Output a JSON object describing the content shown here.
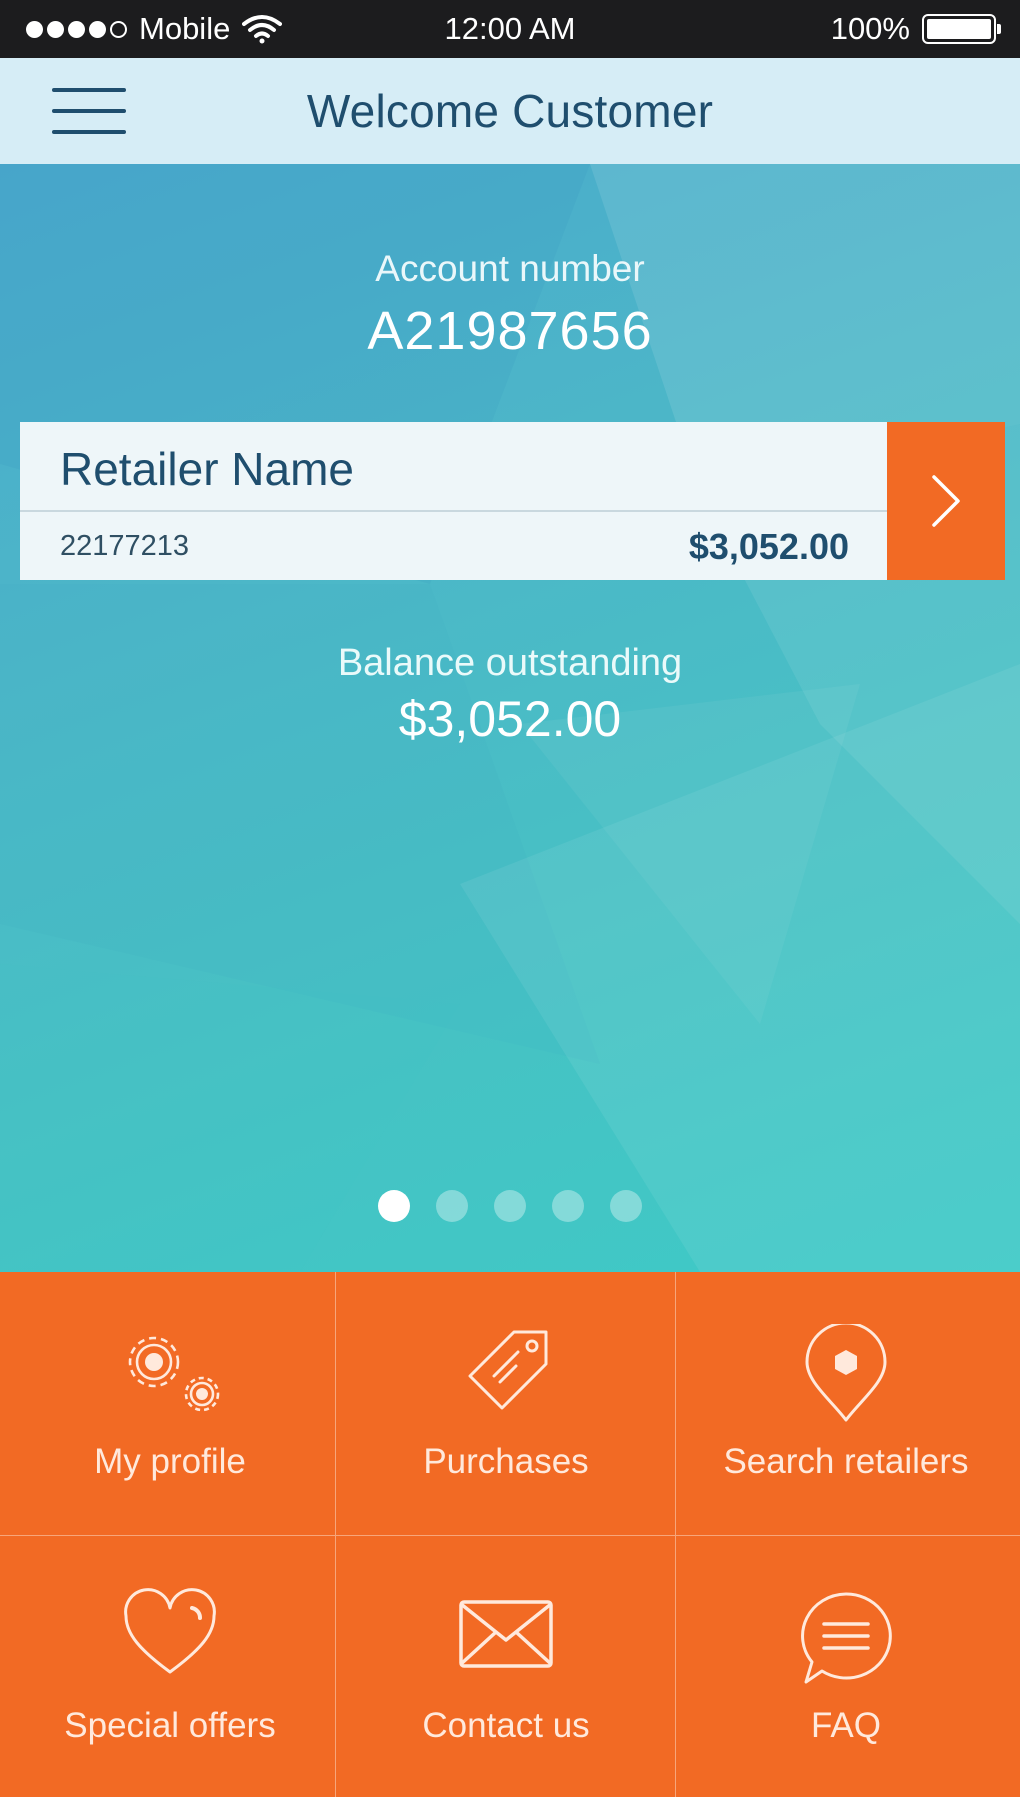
{
  "status_bar": {
    "carrier": "Mobile",
    "time": "12:00 AM",
    "battery": "100%",
    "signal_bars_filled": 4,
    "signal_bars_total": 5
  },
  "header": {
    "title": "Welcome Customer",
    "menu_icon": "hamburger-menu-icon"
  },
  "account": {
    "label": "Account number",
    "number": "A21987656"
  },
  "retailer_card": {
    "name": "Retailer Name",
    "id": "22177213",
    "amount": "$3,052.00",
    "arrow_icon": "chevron-right-icon"
  },
  "balance": {
    "label": "Balance outstanding",
    "value": "$3,052.00"
  },
  "pager": {
    "count": 5,
    "active_index": 0
  },
  "menu_grid": [
    {
      "label": "My profile",
      "icon": "gears-icon"
    },
    {
      "label": "Purchases",
      "icon": "price-tag-icon"
    },
    {
      "label": "Search retailers",
      "icon": "location-pin-icon"
    },
    {
      "label": "Special offers",
      "icon": "heart-icon"
    },
    {
      "label": "Contact us",
      "icon": "envelope-icon"
    },
    {
      "label": "FAQ",
      "icon": "chat-bubble-icon"
    }
  ],
  "colors": {
    "accent_orange": "#f26a24",
    "header_bg": "#d6edf6",
    "header_text": "#1f4e6e",
    "hero_teal": "#47c1c4"
  }
}
